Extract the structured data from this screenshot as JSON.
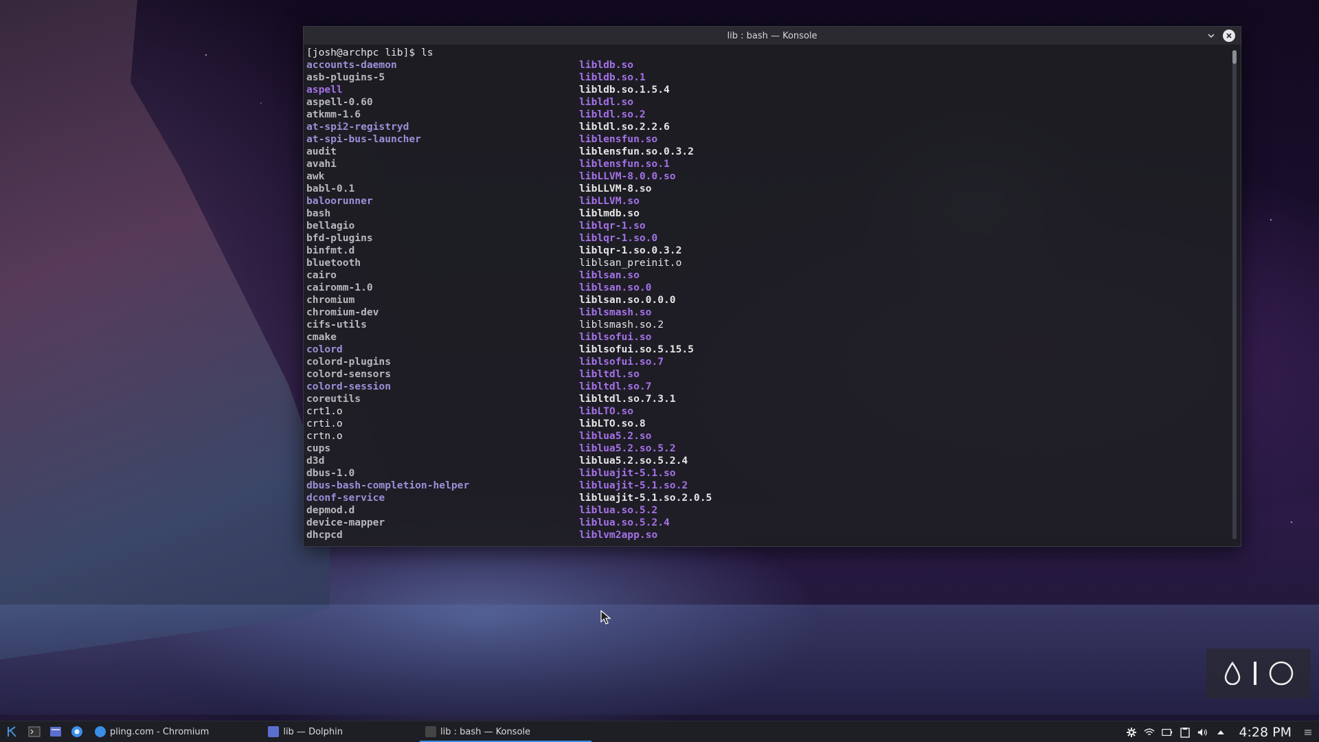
{
  "window": {
    "title": "lib : bash — Konsole",
    "prompt": "[josh@archpc lib]$ ls"
  },
  "listing": {
    "left": [
      {
        "name": "accounts-daemon",
        "type": "dir"
      },
      {
        "name": "asb-plugins-5",
        "type": "exe"
      },
      {
        "name": "aspell",
        "type": "link"
      },
      {
        "name": "aspell-0.60",
        "type": "exe"
      },
      {
        "name": "atkmm-1.6",
        "type": "exe"
      },
      {
        "name": "at-spi2-registryd",
        "type": "dir"
      },
      {
        "name": "at-spi-bus-launcher",
        "type": "dir"
      },
      {
        "name": "audit",
        "type": "exe"
      },
      {
        "name": "avahi",
        "type": "exe"
      },
      {
        "name": "awk",
        "type": "exe"
      },
      {
        "name": "babl-0.1",
        "type": "exe"
      },
      {
        "name": "baloorunner",
        "type": "dir"
      },
      {
        "name": "bash",
        "type": "exe"
      },
      {
        "name": "bellagio",
        "type": "exe"
      },
      {
        "name": "bfd-plugins",
        "type": "exe"
      },
      {
        "name": "binfmt.d",
        "type": "exe"
      },
      {
        "name": "bluetooth",
        "type": "exe"
      },
      {
        "name": "cairo",
        "type": "exe"
      },
      {
        "name": "cairomm-1.0",
        "type": "exe"
      },
      {
        "name": "chromium",
        "type": "exe"
      },
      {
        "name": "chromium-dev",
        "type": "exe"
      },
      {
        "name": "cifs-utils",
        "type": "exe"
      },
      {
        "name": "cmake",
        "type": "exe"
      },
      {
        "name": "colord",
        "type": "dir"
      },
      {
        "name": "colord-plugins",
        "type": "exe"
      },
      {
        "name": "colord-sensors",
        "type": "exe"
      },
      {
        "name": "colord-session",
        "type": "dir"
      },
      {
        "name": "coreutils",
        "type": "exe"
      },
      {
        "name": "crt1.o",
        "type": "file"
      },
      {
        "name": "crti.o",
        "type": "file"
      },
      {
        "name": "crtn.o",
        "type": "file"
      },
      {
        "name": "cups",
        "type": "exe"
      },
      {
        "name": "d3d",
        "type": "exe"
      },
      {
        "name": "dbus-1.0",
        "type": "exe"
      },
      {
        "name": "dbus-bash-completion-helper",
        "type": "dir"
      },
      {
        "name": "dconf-service",
        "type": "dir"
      },
      {
        "name": "depmod.d",
        "type": "exe"
      },
      {
        "name": "device-mapper",
        "type": "exe"
      },
      {
        "name": "dhcpcd",
        "type": "exe"
      }
    ],
    "right": [
      {
        "name": "libldb.so",
        "type": "link"
      },
      {
        "name": "libldb.so.1",
        "type": "link"
      },
      {
        "name": "libldb.so.1.5.4",
        "type": "bold"
      },
      {
        "name": "libldl.so",
        "type": "link"
      },
      {
        "name": "libldl.so.2",
        "type": "link"
      },
      {
        "name": "libldl.so.2.2.6",
        "type": "bold"
      },
      {
        "name": "liblensfun.so",
        "type": "link"
      },
      {
        "name": "liblensfun.so.0.3.2",
        "type": "bold"
      },
      {
        "name": "liblensfun.so.1",
        "type": "link"
      },
      {
        "name": "libLLVM-8.0.0.so",
        "type": "link"
      },
      {
        "name": "libLLVM-8.so",
        "type": "bold"
      },
      {
        "name": "libLLVM.so",
        "type": "link"
      },
      {
        "name": "liblmdb.so",
        "type": "bold"
      },
      {
        "name": "liblqr-1.so",
        "type": "link"
      },
      {
        "name": "liblqr-1.so.0",
        "type": "link"
      },
      {
        "name": "liblqr-1.so.0.3.2",
        "type": "bold"
      },
      {
        "name": "liblsan_preinit.o",
        "type": "file"
      },
      {
        "name": "liblsan.so",
        "type": "link"
      },
      {
        "name": "liblsan.so.0",
        "type": "link"
      },
      {
        "name": "liblsan.so.0.0.0",
        "type": "bold"
      },
      {
        "name": "liblsmash.so",
        "type": "link"
      },
      {
        "name": "liblsmash.so.2",
        "type": "file"
      },
      {
        "name": "liblsofui.so",
        "type": "link"
      },
      {
        "name": "liblsofui.so.5.15.5",
        "type": "bold"
      },
      {
        "name": "liblsofui.so.7",
        "type": "link"
      },
      {
        "name": "libltdl.so",
        "type": "link"
      },
      {
        "name": "libltdl.so.7",
        "type": "link"
      },
      {
        "name": "libltdl.so.7.3.1",
        "type": "bold"
      },
      {
        "name": "libLTO.so",
        "type": "link"
      },
      {
        "name": "libLTO.so.8",
        "type": "bold"
      },
      {
        "name": "liblua5.2.so",
        "type": "link"
      },
      {
        "name": "liblua5.2.so.5.2",
        "type": "link"
      },
      {
        "name": "liblua5.2.so.5.2.4",
        "type": "bold"
      },
      {
        "name": "libluajit-5.1.so",
        "type": "link"
      },
      {
        "name": "libluajit-5.1.so.2",
        "type": "link"
      },
      {
        "name": "libluajit-5.1.so.2.0.5",
        "type": "bold"
      },
      {
        "name": "liblua.so.5.2",
        "type": "link"
      },
      {
        "name": "liblua.so.5.2.4",
        "type": "link"
      },
      {
        "name": "liblvm2app.so",
        "type": "link"
      }
    ]
  },
  "taskbar": {
    "tasks": [
      {
        "label": "pling.com - Chromium",
        "icon": "chromium-icon",
        "color": "#3b8ee8",
        "active": false
      },
      {
        "label": "lib — Dolphin",
        "icon": "dolphin-icon",
        "color": "#5b6fd0",
        "active": false
      },
      {
        "label": "lib : bash — Konsole",
        "icon": "konsole-icon",
        "color": "#444",
        "active": true
      }
    ],
    "clock": "4:28 PM"
  },
  "colors": {
    "dir": "#9d8fd8",
    "link": "#a472e8",
    "accent": "#3b8ee8"
  }
}
